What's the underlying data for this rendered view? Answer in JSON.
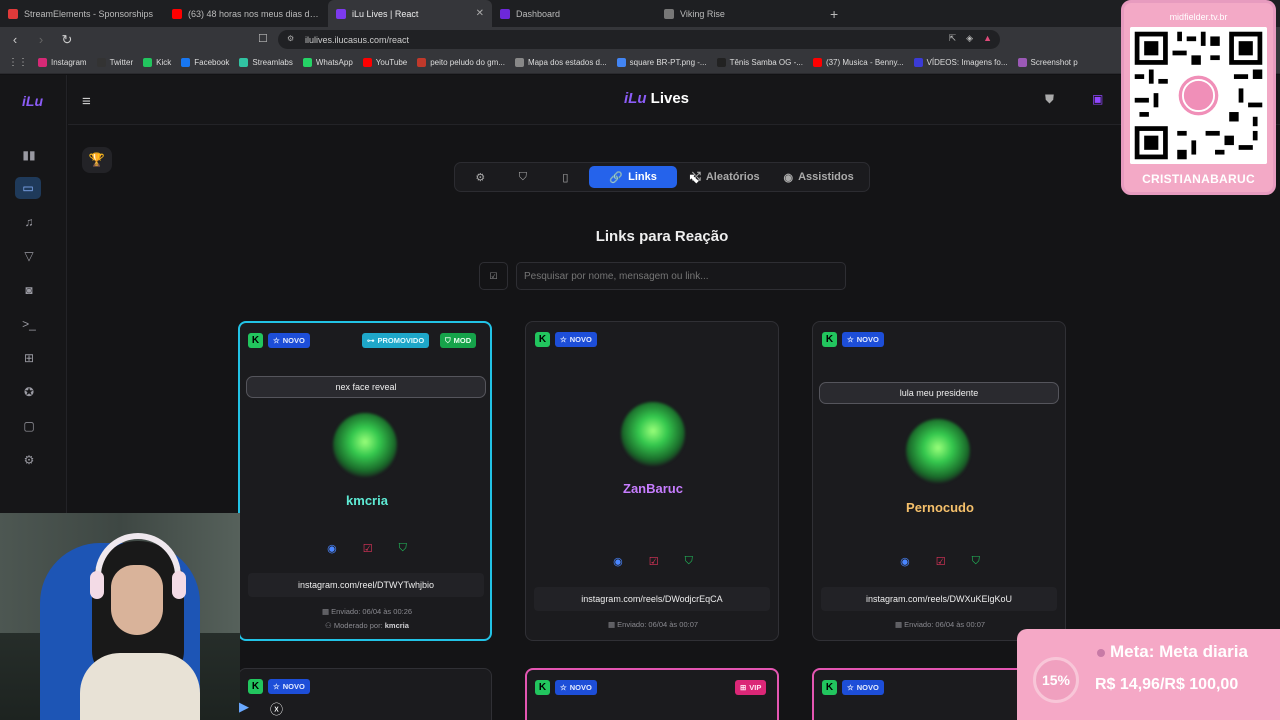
{
  "browser": {
    "tabs": [
      {
        "title": "StreamElements - Sponsorships",
        "color": "#e03a3a",
        "active": false
      },
      {
        "title": "(63) 48 horas nos meus dias de folga",
        "color": "#ff0000",
        "active": false
      },
      {
        "title": "iLu Lives | React",
        "color": "#7c3aed",
        "active": true
      },
      {
        "title": "Dashboard",
        "color": "#6d28d9",
        "active": false
      },
      {
        "title": "Viking Rise",
        "color": "#777777",
        "active": false
      }
    ],
    "new_tab": "+",
    "url": "ilulives.ilucasus.com/react",
    "bookmarks": [
      {
        "label": "Instagram",
        "color": "#d62976"
      },
      {
        "label": "Twitter",
        "color": "#333333"
      },
      {
        "label": "Kick",
        "color": "#22c55e"
      },
      {
        "label": "Facebook",
        "color": "#1877f2"
      },
      {
        "label": "Streamlabs",
        "color": "#31c3a2"
      },
      {
        "label": "WhatsApp",
        "color": "#25d366"
      },
      {
        "label": "YouTube",
        "color": "#ff0000"
      },
      {
        "label": "peito peludo do gm...",
        "color": "#c0392b"
      },
      {
        "label": "Mapa dos estados d...",
        "color": "#888888"
      },
      {
        "label": "square BR-PT.png -...",
        "color": "#4285f4"
      },
      {
        "label": "Tênis Samba OG -...",
        "color": "#222222"
      },
      {
        "label": "(37) Musica - Benny...",
        "color": "#ff0000"
      },
      {
        "label": "VÍDEOS: Imagens fo...",
        "color": "#3b3bd6"
      },
      {
        "label": "Screenshot p",
        "color": "#9b59b6"
      }
    ]
  },
  "app": {
    "brand_small": "iLu",
    "brand_a": "iLu",
    "brand_b": "Lives",
    "tabs": {
      "links": "Links",
      "aleatorios": "Aleatórios",
      "assistidos": "Assistidos"
    },
    "section_title": "Links para Reação",
    "search_placeholder": "Pesquisar por nome, mensagem ou link..."
  },
  "cards": [
    {
      "k": "K",
      "novo": "NOVO",
      "promovido": "PROMOVIDO",
      "mod": "MOD",
      "message": "nex face reveal",
      "user": "kmcria",
      "user_color": "#5eead4",
      "link": "instagram.com/reel/DTWYTwhjbio",
      "sent": "Enviado: 06/04 às 00:26",
      "moderated_label": "Moderado por:",
      "moderated_by": "kmcria"
    },
    {
      "k": "K",
      "novo": "NOVO",
      "user": "ZanBaruc",
      "user_color": "#c77dff",
      "link": "instagram.com/reels/DWodjcrEqCA",
      "sent": "Enviado: 06/04 às 00:07"
    },
    {
      "k": "K",
      "novo": "NOVO",
      "message": "lula meu presidente",
      "user": "Pernocudo",
      "user_color": "#f5c06b",
      "link": "instagram.com/reels/DWXuKElgKoU",
      "sent": "Enviado: 06/04 às 00:07"
    }
  ],
  "bottom_cards": [
    {
      "k": "K",
      "novo": "NOVO"
    },
    {
      "k": "K",
      "novo": "NOVO",
      "vip": "VIP"
    },
    {
      "k": "K",
      "novo": "NOVO"
    }
  ],
  "overlay": {
    "qr_title": "midfielder.tv.br",
    "qr_name": "CRISTIANABARUC",
    "goal_percent": "15%",
    "goal_title": "Meta: Meta diaria",
    "goal_value": "R$ 14,96/R$ 100,00"
  }
}
